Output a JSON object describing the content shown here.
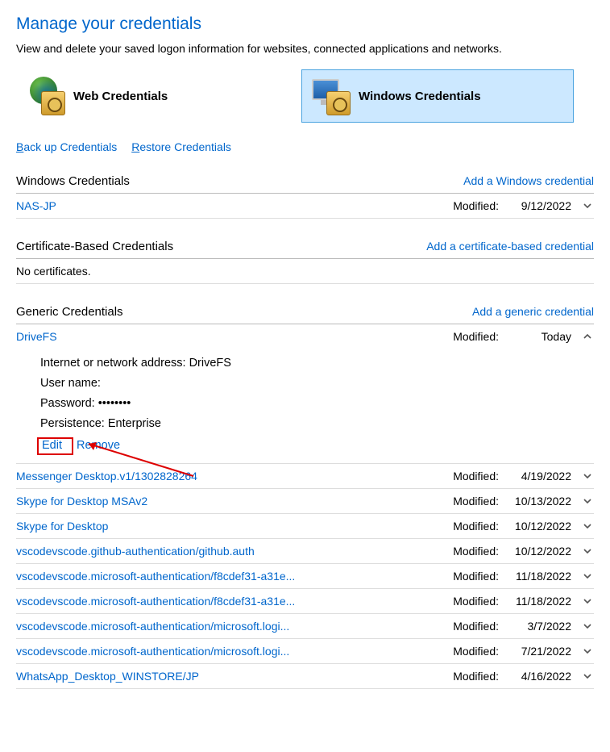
{
  "header": {
    "title": "Manage your credentials",
    "description": "View and delete your saved logon information for websites, connected applications and networks."
  },
  "tiles": {
    "web": "Web Credentials",
    "windows": "Windows Credentials"
  },
  "links": {
    "backup": "ack up Credentials",
    "backup_u": "B",
    "restore": "estore Credentials",
    "restore_u": "R"
  },
  "sections": {
    "windows": {
      "title": "Windows Credentials",
      "add": "Add a Windows credential"
    },
    "cert": {
      "title": "Certificate-Based Credentials",
      "add": "Add a certificate-based credential",
      "empty": "No certificates."
    },
    "generic": {
      "title": "Generic Credentials",
      "add": "Add a generic credential"
    }
  },
  "labels": {
    "modified": "Modified:",
    "addr_label": "Internet or network address:  ",
    "user_label": "User name:",
    "pass_label": "Password:  ",
    "persist_label": "Persistence:  ",
    "edit": "Edit",
    "remove": "Remove"
  },
  "windows_items": [
    {
      "name": "NAS-JP",
      "modified": "9/12/2022"
    }
  ],
  "generic_expanded": {
    "name": "DriveFS",
    "modified": "Today",
    "addr_val": "DriveFS",
    "user_val": "",
    "pass_val": "••••••••",
    "persist_val": "Enterprise"
  },
  "generic_items": [
    {
      "name": "Messenger Desktop.v1/1302828264",
      "modified": "4/19/2022"
    },
    {
      "name": "Skype for Desktop MSAv2",
      "modified": "10/13/2022"
    },
    {
      "name": "Skype for Desktop",
      "modified": "10/12/2022"
    },
    {
      "name": "vscodevscode.github-authentication/github.auth",
      "modified": "10/12/2022"
    },
    {
      "name": "vscodevscode.microsoft-authentication/f8cdef31-a31e...",
      "modified": "11/18/2022"
    },
    {
      "name": "vscodevscode.microsoft-authentication/f8cdef31-a31e...",
      "modified": "11/18/2022"
    },
    {
      "name": "vscodevscode.microsoft-authentication/microsoft.logi...",
      "modified": "3/7/2022"
    },
    {
      "name": "vscodevscode.microsoft-authentication/microsoft.logi...",
      "modified": "7/21/2022"
    },
    {
      "name": "WhatsApp_Desktop_WINSTORE/JP",
      "modified": "4/16/2022"
    }
  ]
}
